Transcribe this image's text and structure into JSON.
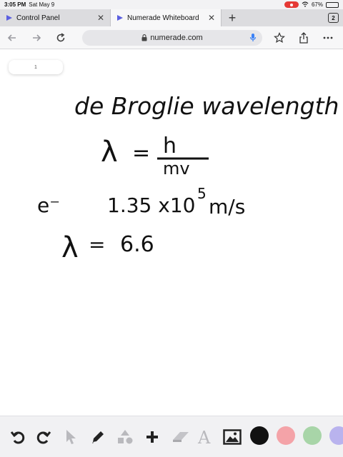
{
  "status": {
    "time": "3:05 PM",
    "date": "Sat May 9",
    "battery": "67%",
    "battery_level": 0.67
  },
  "tabs": [
    {
      "label": "Control Panel",
      "active": false
    },
    {
      "label": "Numerade Whiteboard",
      "active": true
    }
  ],
  "tab_count": "2",
  "url": "numerade.com",
  "page_indicator": "1",
  "handwriting": {
    "line1": "de Broglie wavelength",
    "line2_lhs": "λ",
    "line2_eq": "=",
    "line2_num": "h",
    "line2_den": "mv",
    "line3_particle": "e⁻",
    "line3_value": "1.35 x10",
    "line3_exp": "5",
    "line3_unit": "m/s",
    "line4_lhs": "λ",
    "line4_eq": "=",
    "line4_value": "6.6"
  },
  "colors": {
    "accent_blue": "#3b82f6",
    "record_red": "#e53935",
    "swatch_black": "#111111",
    "swatch_pink": "#f4a3a8",
    "swatch_green": "#a8d5a8",
    "swatch_lavender": "#b9b3ee"
  },
  "tools": [
    "undo-icon",
    "redo-icon",
    "pointer-icon",
    "pen-icon",
    "shapes-icon",
    "plus-icon",
    "eraser-icon",
    "text-icon",
    "image-icon"
  ]
}
